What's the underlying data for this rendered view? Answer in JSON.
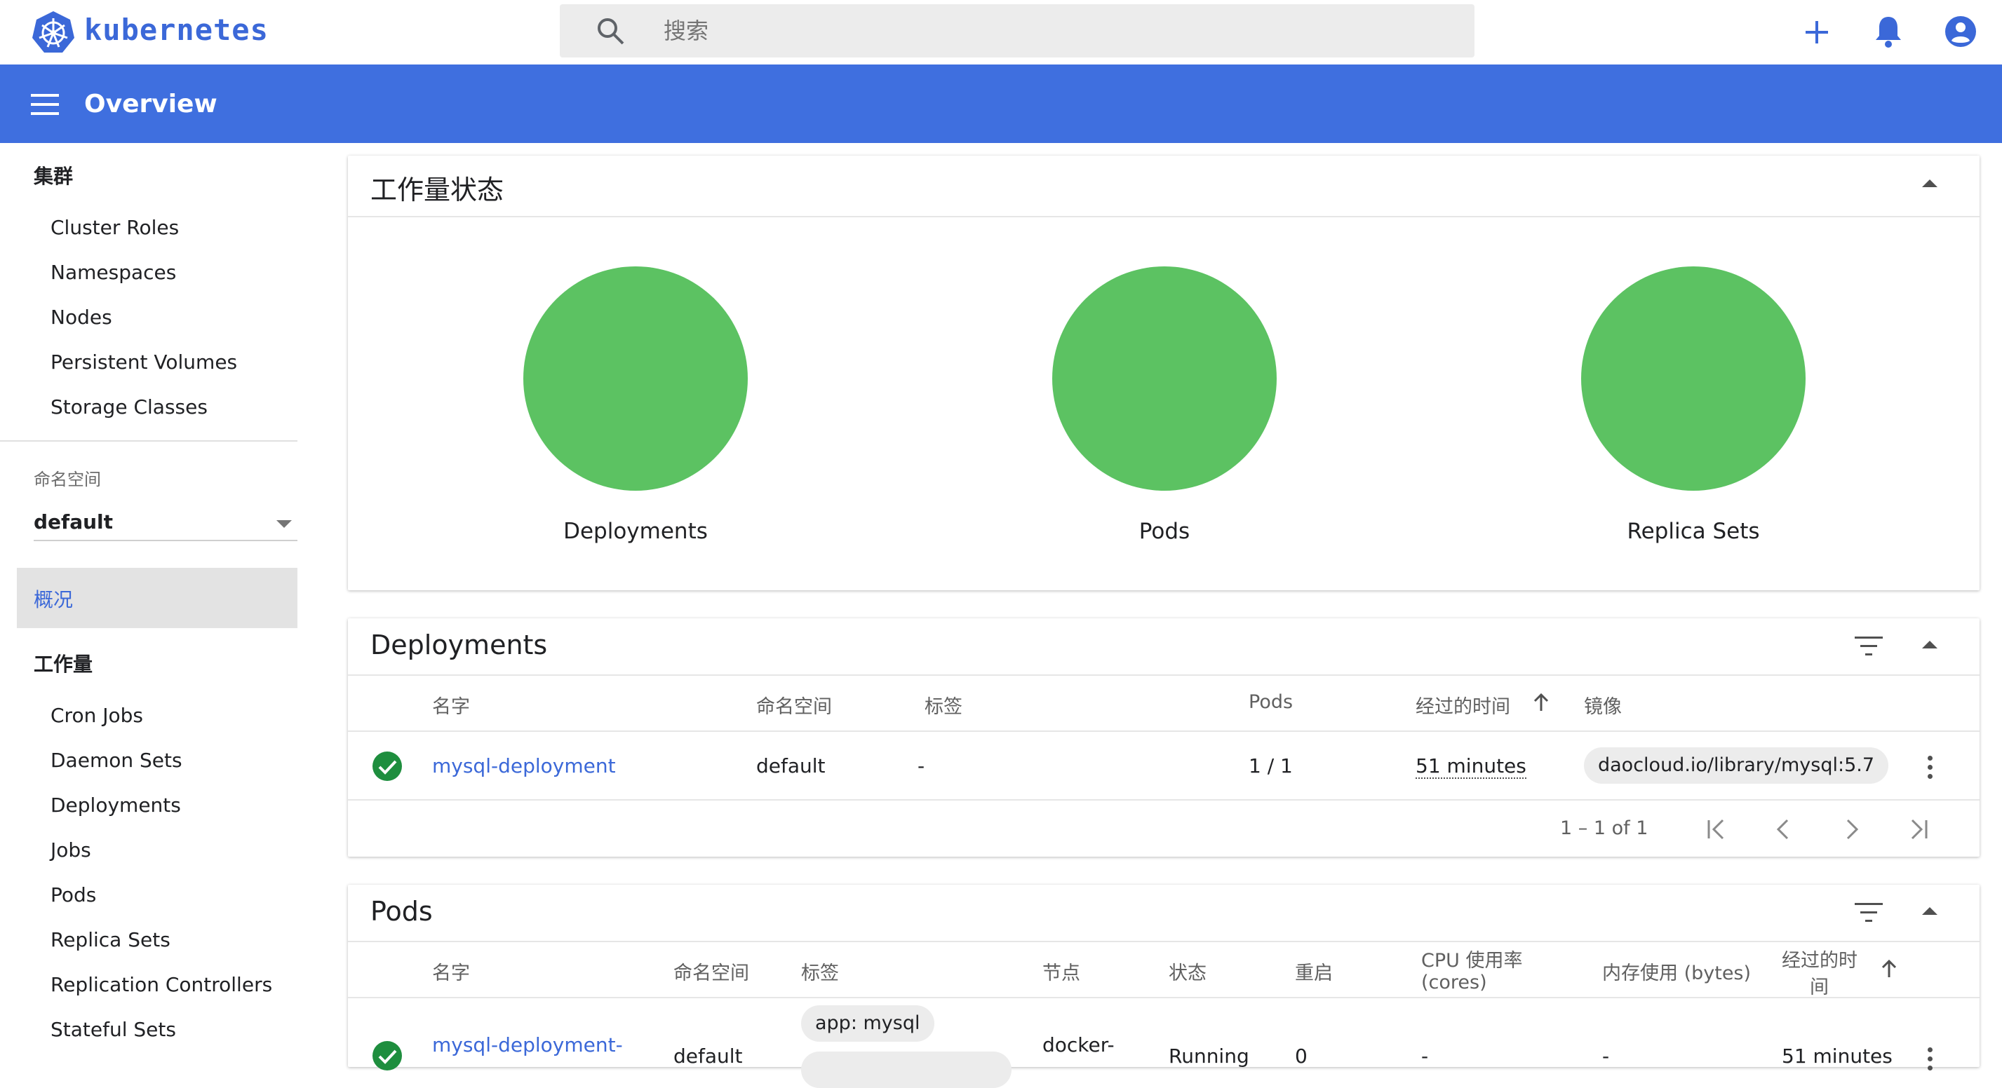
{
  "app": {
    "brand": "kubernetes",
    "brand_color": "#3b68d8"
  },
  "search": {
    "placeholder": "搜索"
  },
  "header": {
    "title": "Overview",
    "color": "#3f6fdf"
  },
  "sidebar": {
    "cluster_heading": "集群",
    "cluster_items": [
      "Cluster Roles",
      "Namespaces",
      "Nodes",
      "Persistent Volumes",
      "Storage Classes"
    ],
    "namespace_label": "命名空间",
    "namespace_value": "default",
    "overview_label": "概况",
    "workload_heading": "工作量",
    "workload_items": [
      "Cron Jobs",
      "Daemon Sets",
      "Deployments",
      "Jobs",
      "Pods",
      "Replica Sets",
      "Replication Controllers",
      "Stateful Sets"
    ]
  },
  "workload_status": {
    "title": "工作量状态",
    "items": [
      {
        "label": "Deployments",
        "status_color": "#5cc262"
      },
      {
        "label": "Pods",
        "status_color": "#5cc262"
      },
      {
        "label": "Replica Sets",
        "status_color": "#5cc262"
      }
    ]
  },
  "deployments": {
    "title": "Deployments",
    "columns": [
      "名字",
      "命名空间",
      "标签",
      "Pods",
      "经过的时间",
      "镜像"
    ],
    "rows": [
      {
        "name": "mysql-deployment",
        "namespace": "default",
        "labels": "-",
        "pods": "1 / 1",
        "age": "51 minutes",
        "image": "daocloud.io/library/mysql:5.7"
      }
    ],
    "pagination": "1 – 1 of 1"
  },
  "pods": {
    "title": "Pods",
    "columns": [
      "名字",
      "命名空间",
      "标签",
      "节点",
      "状态",
      "重启",
      "CPU 使用率",
      "(cores)",
      "内存使用 (bytes)",
      "经过的时",
      "间"
    ],
    "rows": [
      {
        "name": "mysql-deployment-",
        "namespace": "default",
        "label": "app: mysql",
        "node": "docker-",
        "status": "Running",
        "restarts": "0",
        "cpu": "-",
        "memory": "-",
        "age": "51 minutes"
      }
    ]
  }
}
